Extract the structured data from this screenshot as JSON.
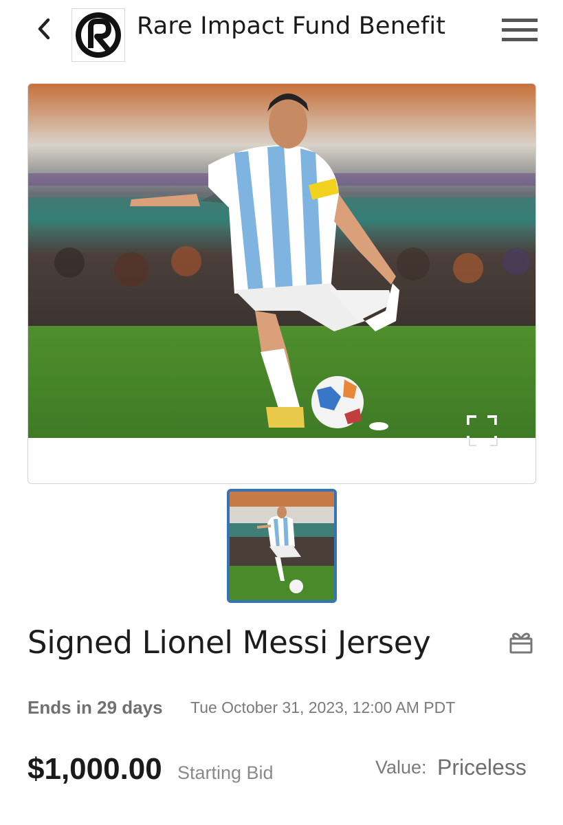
{
  "header": {
    "title": "Rare Impact Fund Benefit",
    "back_icon": "chevron-left-icon",
    "logo_icon": "rare-logo",
    "menu_icon": "hamburger-menu-icon"
  },
  "gallery": {
    "main_image": "photo-soccer-player-kicking-ball",
    "expand_icon": "fullscreen-expand-icon",
    "thumbnails": [
      "photo-soccer-player-kicking-ball"
    ],
    "selected_thumbnail": 1,
    "accent_color": "#3573b9"
  },
  "item": {
    "title": "Signed Lionel Messi Jersey",
    "gift_icon": "gift-icon",
    "ends_in": "Ends in 29 days",
    "end_date": "Tue October 31, 2023, 12:00 AM PDT",
    "price": "$1,000.00",
    "price_label": "Starting Bid",
    "value_label": "Value:",
    "value": "Priceless"
  }
}
